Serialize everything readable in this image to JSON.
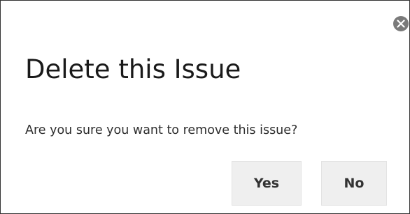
{
  "dialog": {
    "title": "Delete this Issue",
    "message": "Are you sure you want to remove this issue?",
    "close_icon": "close-icon",
    "buttons": {
      "yes_label": "Yes",
      "no_label": "No"
    }
  },
  "colors": {
    "close_icon_bg": "#7a7a7a",
    "button_bg": "#efefef",
    "text": "#1a1a1a",
    "border": "#333333"
  }
}
